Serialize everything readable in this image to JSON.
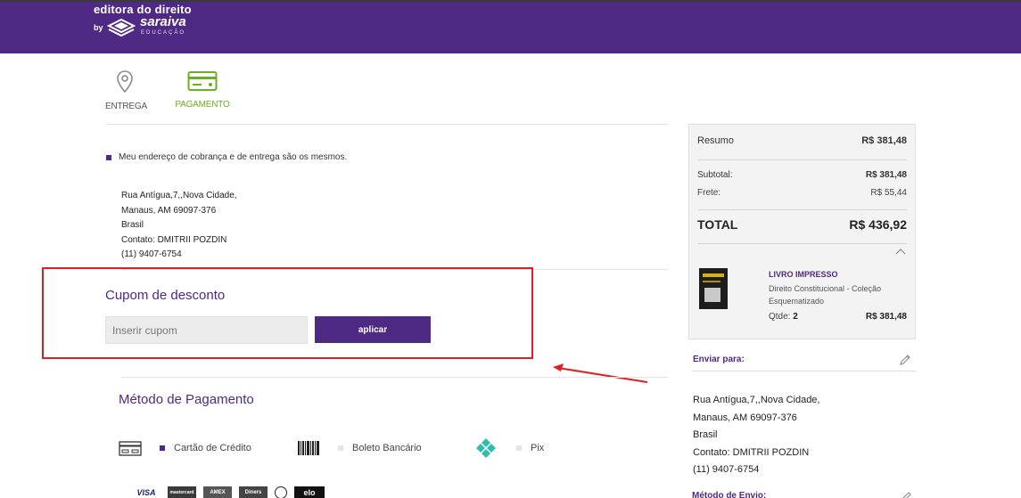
{
  "brand": {
    "top_text": "editora do direito",
    "by": "by",
    "name": "saraiva",
    "sub": "EDUCAÇÃO"
  },
  "steps": [
    {
      "label": "ENTREGA",
      "icon": "location-pin-icon"
    },
    {
      "label": "PAGAMENTO",
      "icon": "credit-card-icon"
    }
  ],
  "billing": {
    "same_address_text": "Meu endereço de cobrança e de entrega são os mesmos.",
    "address_lines": [
      "Rua Antígua,7,,Nova Cidade,",
      "Manaus, AM 69097-376",
      "Brasil",
      "Contato: DMITRII POZDIN",
      "(11) 9407-6754"
    ]
  },
  "coupon": {
    "title": "Cupom de desconto",
    "placeholder": "Inserir cupom",
    "button_label": "aplicar"
  },
  "payment": {
    "title": "Método de Pagamento",
    "options": [
      {
        "label": "Cartão de Crédito",
        "selected": true
      },
      {
        "label": "Boleto Bancário",
        "selected": false
      },
      {
        "label": "Pix",
        "selected": false
      }
    ],
    "card_brands": [
      "VISA",
      "mastercard",
      "AMEX",
      "Diners",
      "elo"
    ]
  },
  "summary": {
    "resumo_label": "Resumo",
    "resumo_value": "R$ 381,48",
    "subtotal_label": "Subtotal:",
    "subtotal_value": "R$ 381,48",
    "frete_label": "Frete:",
    "frete_value": "R$ 55,44",
    "total_label": "TOTAL",
    "total_value": "R$ 436,92",
    "item": {
      "type": "LIVRO IMPRESSO",
      "description": "Direito Constitucional - Coleção Esquematizado",
      "qty_label": "Qtde:",
      "qty": "2",
      "price": "R$ 381,48"
    }
  },
  "shipping": {
    "label": "Enviar para:",
    "address_lines": [
      "Rua Antígua,7,,Nova Cidade,",
      "Manaus, AM 69097-376",
      "Brasil",
      "Contato: DMITRII POZDIN",
      "(11) 9407-6754"
    ],
    "method_label": "Método de Envio:"
  },
  "colors": {
    "brand_purple": "#4e2a84",
    "active_green": "#6bb01e",
    "highlight_red": "#e02020"
  }
}
